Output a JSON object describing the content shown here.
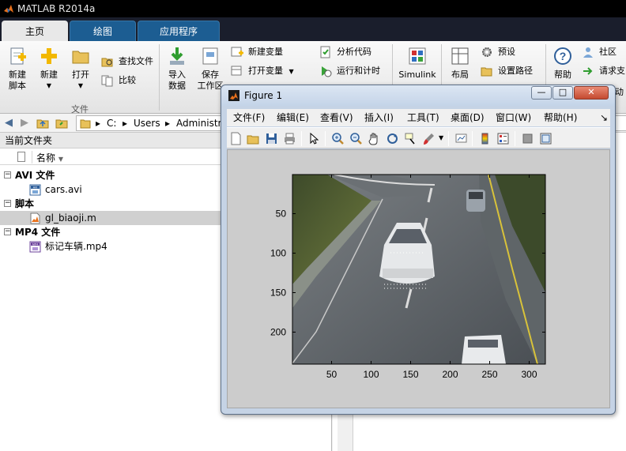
{
  "app": {
    "title": "MATLAB R2014a"
  },
  "tabs": [
    {
      "label": "主页",
      "active": true
    },
    {
      "label": "绘图",
      "active": false
    },
    {
      "label": "应用程序",
      "active": false
    }
  ],
  "ribbon": {
    "new_script": "新建\n脚本",
    "new": "新建",
    "open": "打开",
    "find_files": "查找文件",
    "compare": "比较",
    "file_group": "文件",
    "import_data": "导入\n数据",
    "save_workspace": "保存\n工作区",
    "new_variable": "新建变量",
    "open_variable": "打开变量",
    "analyze_code": "分析代码",
    "run_and_time": "运行和计时",
    "simulink": "Simulink",
    "layout": "布局",
    "preferences": "预设",
    "set_path": "设置路径",
    "help": "帮助",
    "community": "社区",
    "request_support": "请求支",
    "extra": "动"
  },
  "address": {
    "segments": [
      "C:",
      "Users",
      "Administr"
    ]
  },
  "current_folder": {
    "header": "当前文件夹",
    "column_name": "名称",
    "groups": [
      {
        "label": "AVI 文件",
        "files": [
          {
            "name": "cars.avi",
            "type": "avi"
          }
        ]
      },
      {
        "label": "脚本",
        "files": [
          {
            "name": "gl_biaoji.m",
            "type": "m",
            "selected": true
          }
        ]
      },
      {
        "label": "MP4 文件",
        "files": [
          {
            "name": "标记车辆.mp4",
            "type": "mp4"
          }
        ]
      }
    ]
  },
  "figure": {
    "title": "Figure 1",
    "window_buttons": {
      "minimize": "—",
      "maximize": "□",
      "close": "✕"
    },
    "menu": [
      "文件(F)",
      "编辑(E)",
      "查看(V)",
      "插入(I)",
      "工具(T)",
      "桌面(D)",
      "窗口(W)",
      "帮助(H)"
    ],
    "menu_arrow": "↘",
    "axes": {
      "x_ticks": [
        50,
        100,
        150,
        200,
        250,
        300
      ],
      "y_ticks": [
        50,
        100,
        150,
        200
      ],
      "xlim": [
        0.5,
        320.5
      ],
      "ylim": [
        0.5,
        240.5
      ],
      "y_reversed": true
    }
  },
  "colors": {
    "tab_active_bg": "#e8e8e8",
    "tab_bg": "#1c5d92",
    "selection_bg": "#d0d0d0",
    "matlab_orange": "#e8701a"
  }
}
